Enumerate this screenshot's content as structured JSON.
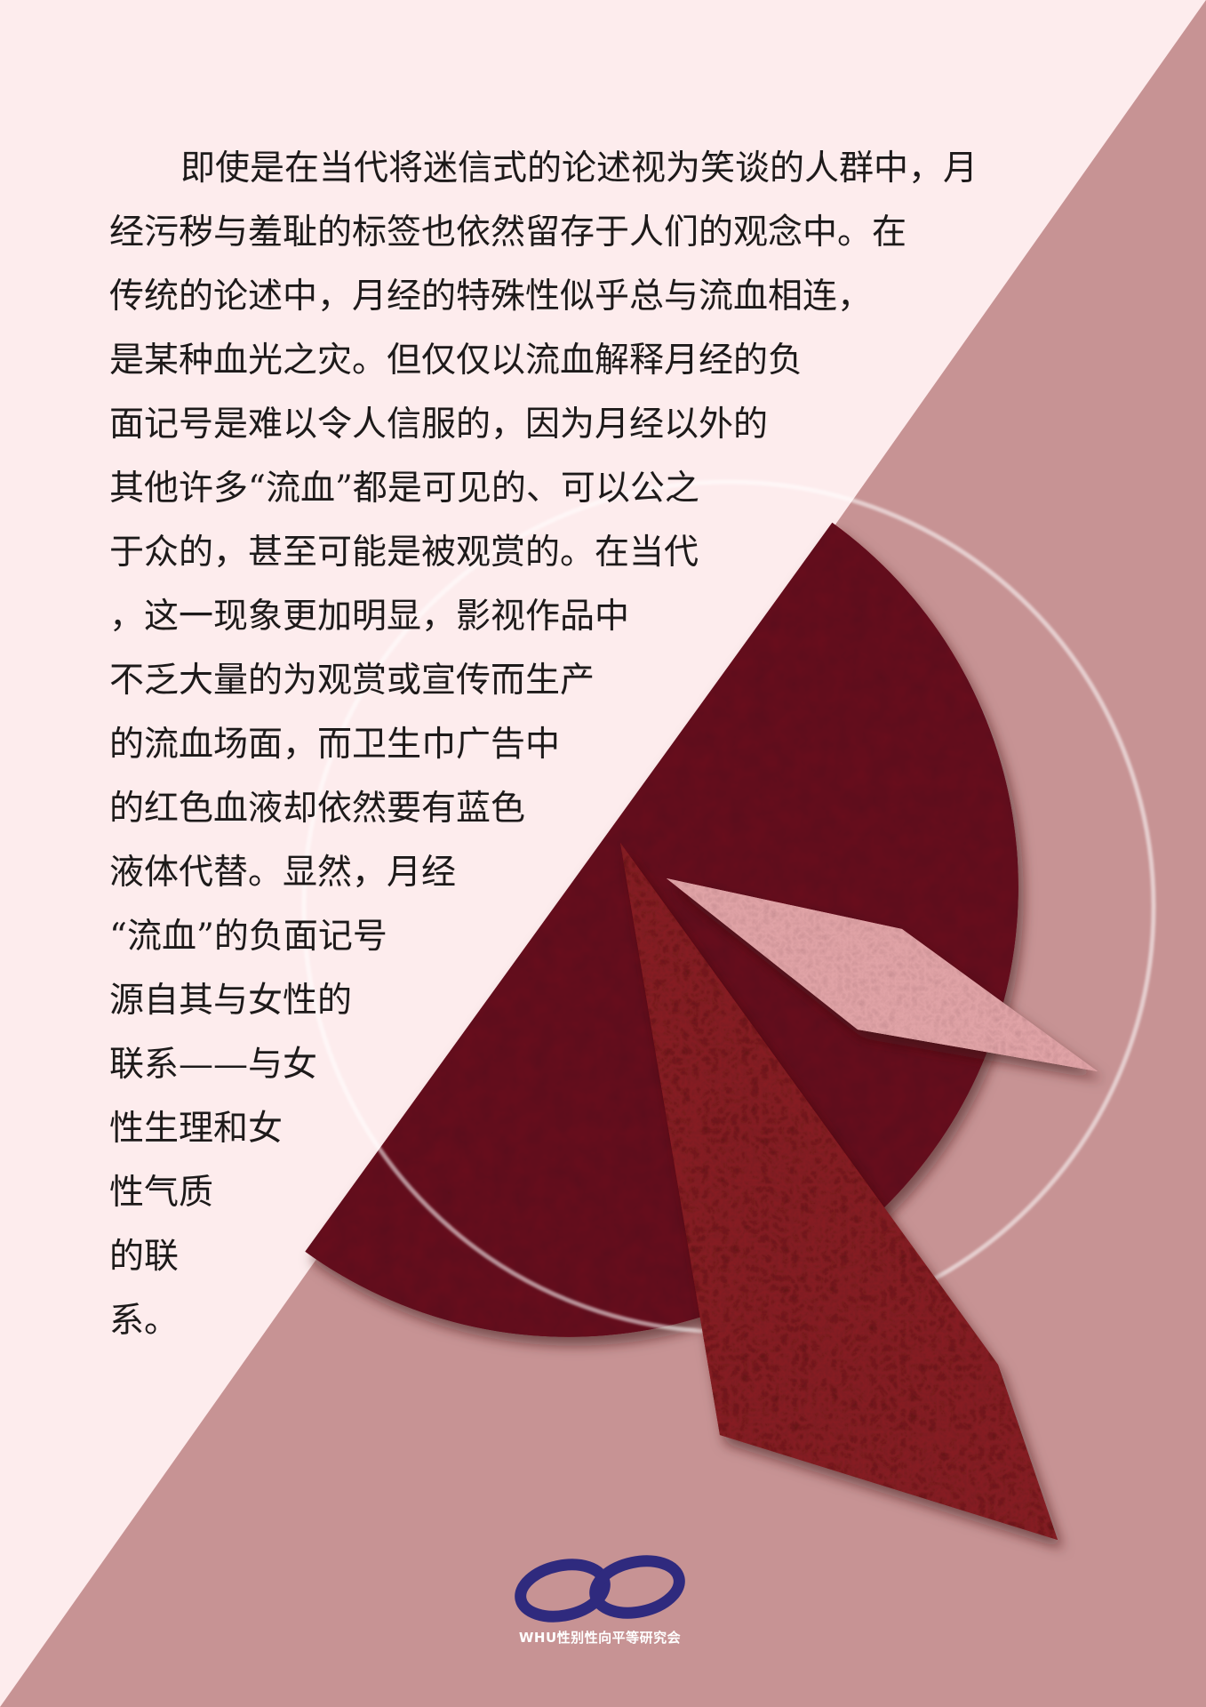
{
  "colors": {
    "background_light": "#fdeced",
    "background_dusty": "#c79394",
    "circle": "#6b1524",
    "long_kite": "#8a2126",
    "small_kite": "#e3a6a9",
    "logo": "#2f2a7e"
  },
  "body": {
    "lines": [
      "即使是在当代将迷信式的论述视为笑谈的人群中，月",
      "经污秽与羞耻的标签也依然留存于人们的观念中。在",
      "传统的论述中，月经的特殊性似乎总与流血相连，",
      "是某种血光之灾。但仅仅以流血解释月经的负",
      "面记号是难以令人信服的，因为月经以外的",
      "其他许多“流血”都是可见的、可以公之",
      "于众的，甚至可能是被观赏的。在当代",
      "，这一现象更加明显，影视作品中",
      "不乏大量的为观赏或宣传而生产",
      "的流血场面，而卫生巾广告中",
      "的红色血液却依然要有蓝色",
      "液体代替。显然，月经",
      "“流血”的负面记号",
      "源自其与女性的",
      "联系——与女",
      "性生理和女",
      "性气质",
      "的联",
      "系。"
    ]
  },
  "logo": {
    "icon": "infinity-loop-icon",
    "text": "WHU性别性向平等研究会"
  }
}
